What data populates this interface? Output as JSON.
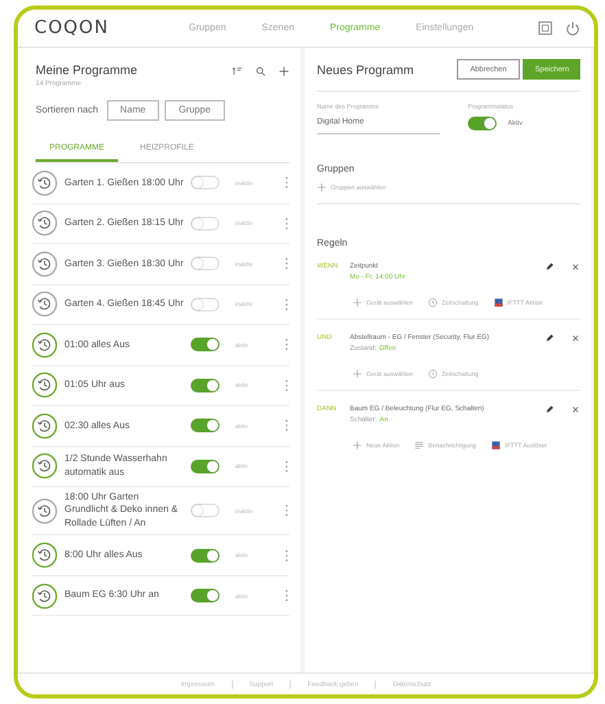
{
  "header": {
    "logo": "COQON",
    "nav": [
      {
        "label": "Gruppen",
        "selected": false
      },
      {
        "label": "Szenen",
        "selected": false
      },
      {
        "label": "Programme",
        "selected": true
      },
      {
        "label": "Einstellungen",
        "selected": false
      }
    ]
  },
  "programs_panel": {
    "title": "Meine Programme",
    "subtitle": "14 Programme",
    "sort_label": "Sortieren nach",
    "sort_buttons": [
      "Name",
      "Gruppe"
    ],
    "tabs": [
      {
        "label": "PROGRAMME",
        "selected": true
      },
      {
        "label": "HEIZPROFILE",
        "selected": false
      }
    ],
    "programs": [
      {
        "name": "Garten 1. Gießen 18:00 Uhr",
        "on": false,
        "status": "inaktiv"
      },
      {
        "name": "Garten 2. Gießen 18:15 Uhr",
        "on": false,
        "status": "inaktiv"
      },
      {
        "name": "Garten 3. Gießen 18:30 Uhr",
        "on": false,
        "status": "inaktiv"
      },
      {
        "name": "Garten 4. Gießen 18:45 Uhr",
        "on": false,
        "status": "inaktiv"
      },
      {
        "name": "01:00 alles Aus",
        "on": true,
        "status": "aktiv"
      },
      {
        "name": "01:05 Uhr aus",
        "on": true,
        "status": "aktiv"
      },
      {
        "name": "02:30 alles Aus",
        "on": true,
        "status": "aktiv"
      },
      {
        "name": "1/2 Stunde Wasserhahn automatik aus",
        "on": true,
        "status": "aktiv"
      },
      {
        "name": "18:00 Uhr Garten Grundlicht & Deko innen & Rollade Lüften / An",
        "on": false,
        "status": "inaktiv"
      },
      {
        "name": "8:00 Uhr alles Aus",
        "on": true,
        "status": "aktiv"
      },
      {
        "name": "Baum EG 6:30 Uhr an",
        "on": true,
        "status": "aktiv"
      }
    ]
  },
  "editor": {
    "title": "Neues Programm",
    "buttons": [
      {
        "label": "Abbrechen",
        "kind": "secondary"
      },
      {
        "label": "Speichern",
        "kind": "primary"
      }
    ],
    "name_field": {
      "label": "Name des Programms",
      "value": "Digital Home"
    },
    "status": {
      "label": "Programmstatus",
      "on": true,
      "text": "Aktiv"
    },
    "groups": {
      "title": "Gruppen",
      "add": "Gruppen auswählen"
    },
    "rules_title": "Regeln",
    "rules": [
      {
        "keyword": "WENN",
        "title": "Zeitpunkt",
        "detail_value": "Mo - Fr, 14:00 Uhr",
        "actions": [
          {
            "kind": "add",
            "label": "Gerät auswählen"
          },
          {
            "kind": "clock",
            "label": "Zeitschaltung"
          },
          {
            "kind": "ifttt",
            "label": "IFTTT Aktion"
          }
        ]
      },
      {
        "keyword": "UND",
        "title": "Abstellraum - EG / Fenster (Security, Flur EG)",
        "detail_label": "Zustand:",
        "detail_value": "Offen",
        "actions": [
          {
            "kind": "add",
            "label": "Gerät auswählen"
          },
          {
            "kind": "clock",
            "label": "Zeitschaltung"
          }
        ]
      },
      {
        "keyword": "DANN",
        "title": "Baum EG / Beleuchtung (Flur EG, Schalten)",
        "detail_label": "Schalter:",
        "detail_value": "An",
        "actions": [
          {
            "kind": "add",
            "label": "Neue Aktion"
          },
          {
            "kind": "notify",
            "label": "Benachrichtigung"
          },
          {
            "kind": "ifttt",
            "label": "IFTTT Auslöser"
          }
        ]
      }
    ]
  },
  "footer": [
    "Impressum",
    "Support",
    "Feedback geben",
    "Datenschutz"
  ]
}
